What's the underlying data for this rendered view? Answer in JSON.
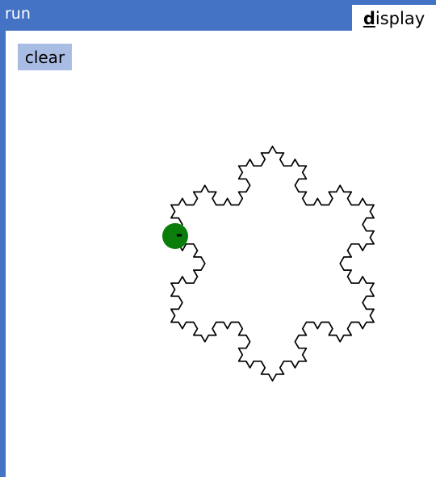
{
  "window": {
    "title": "run"
  },
  "tab": {
    "mnemonic": "d",
    "rest": "isplay"
  },
  "toolbar": {
    "clear_label": "clear"
  },
  "turtle": {
    "label": "-",
    "color": "#0a7d0a"
  },
  "colors": {
    "accent": "#4472c4",
    "button": "#a9bce3",
    "stroke": "#000000"
  }
}
